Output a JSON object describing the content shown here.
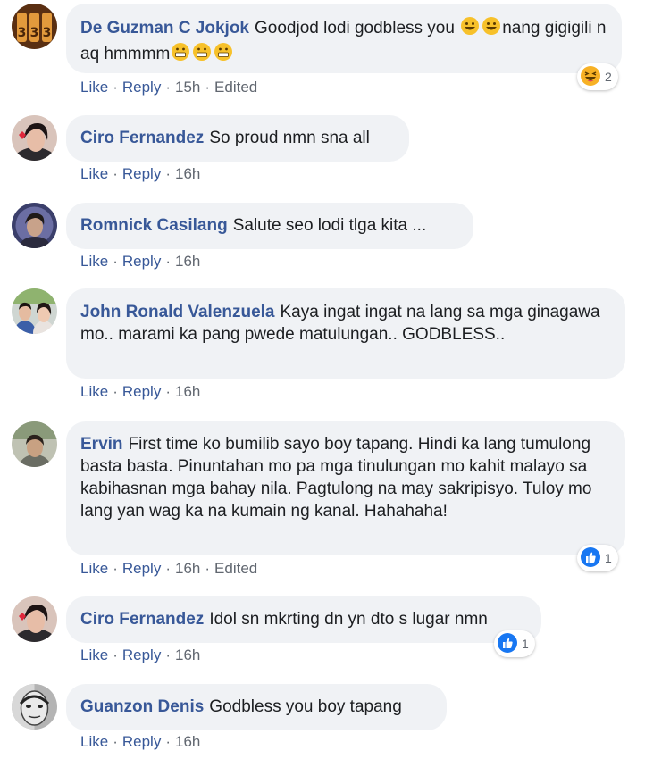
{
  "actions": {
    "like": "Like",
    "reply": "Reply",
    "sep": "·"
  },
  "comments": [
    {
      "name": "De Guzman C Jokjok",
      "text_a": "Goodjod lodi godbless you",
      "text_b": "nang gigigili n aq hmmmm",
      "time": "15h",
      "edited": "Edited",
      "reaction": {
        "icon": "haha-icon",
        "count": "2"
      }
    },
    {
      "name": "Ciro Fernandez",
      "text": "So proud nmn sna all",
      "time": "16h"
    },
    {
      "name": "Romnick Casilang",
      "text": "Salute seo lodi tlga kita ...",
      "time": "16h"
    },
    {
      "name": "John Ronald Valenzuela",
      "text": "Kaya ingat ingat na lang sa mga ginagawa mo.. marami ka pang pwede matulungan.. GODBLESS..",
      "time": "16h"
    },
    {
      "name": "Ervin",
      "text": "First time ko bumilib sayo boy tapang. Hindi ka lang tumulong basta basta. Pinuntahan mo pa mga tinulungan mo kahit malayo sa kabihasnan mga bahay nila. Pagtulong na may sakripisyo. Tuloy mo lang yan wag ka na kumain ng kanal. Hahahaha!",
      "time": "16h",
      "edited": "Edited",
      "reaction": {
        "icon": "like-icon",
        "count": "1"
      }
    },
    {
      "name": "Ciro Fernandez",
      "text": "Idol sn mkrting dn yn dto s lugar nmn",
      "time": "16h",
      "reaction": {
        "icon": "like-icon",
        "count": "1"
      }
    },
    {
      "name": "Guanzon Denis",
      "text": "Godbless you boy tapang",
      "time": "16h"
    }
  ],
  "colors": {
    "name": "#385898",
    "bubble": "#f0f2f5",
    "meta": "#616770",
    "like_blue": "#1877f2",
    "haha_yellow": "#f7b125"
  }
}
